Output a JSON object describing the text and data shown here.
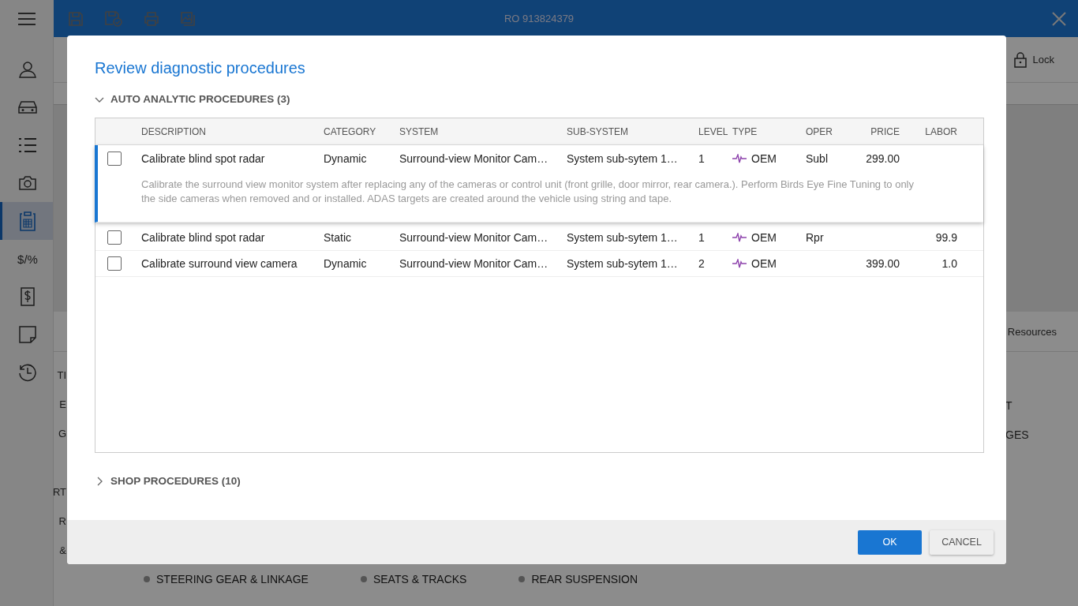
{
  "topbar": {
    "title": "RO 913824379"
  },
  "sidebar": {
    "items": [
      {
        "selected": false
      },
      {
        "selected": false
      },
      {
        "selected": false
      },
      {
        "selected": false
      },
      {
        "selected": true
      },
      {
        "selected": false,
        "glyph": "$/%"
      },
      {
        "selected": false
      },
      {
        "selected": false
      },
      {
        "selected": false
      }
    ]
  },
  "header": {
    "lock_label": "Lock"
  },
  "resources": {
    "label": "Resources"
  },
  "background_left": [
    "TI",
    "E",
    "G",
    "RT",
    "R",
    "&"
  ],
  "background_right": [
    "T",
    "GES"
  ],
  "background_tags": [
    "STEERING GEAR & LINKAGE",
    "SEATS & TRACKS",
    "REAR SUSPENSION"
  ],
  "dialog": {
    "title": "Review diagnostic procedures",
    "sections": [
      {
        "title": "AUTO ANALYTIC PROCEDURES (3)",
        "expanded": true
      },
      {
        "title": "SHOP PROCEDURES (10)",
        "expanded": false
      }
    ],
    "table": {
      "columns": [
        "DESCRIPTION",
        "CATEGORY",
        "SYSTEM",
        "SUB-SYSTEM",
        "LEVEL",
        "TYPE",
        "OPER",
        "PRICE",
        "LABOR"
      ],
      "rows": [
        {
          "checked": false,
          "expanded": true,
          "description": "Calibrate blind spot radar",
          "category": "Dynamic",
          "system": "Surround-view Monitor Cam…",
          "sub_system": "System sub-sytem 1…",
          "proc_level": "1",
          "type": "OEM",
          "oper": "Subl",
          "price": "299.00",
          "details": "Calibrate the surround view monitor system after replacing any of the cameras or control unit (front grille, door mirror, rear camera.). Perform Birds Eye Fine Tuning to only the side cameras when removed and or installed. ADAS targets are created around the vehicle using string and tape."
        },
        {
          "checked": false,
          "expanded": false,
          "description": "Calibrate blind spot radar",
          "category": "Static",
          "system": "Surround-view Monitor Cam…",
          "sub_system": "System sub-sytem 1…",
          "proc_level": "1",
          "type": "OEM",
          "oper": "Rpr",
          "labor": "99.9"
        },
        {
          "checked": false,
          "expanded": false,
          "description": "Calibrate surround view camera",
          "category": "Dynamic",
          "system": "Surround-view Monitor Cam…",
          "sub_system": "System sub-sytem 1…",
          "proc_level": "2",
          "type": "OEM",
          "price": "399.00",
          "labor": "1.0"
        }
      ]
    },
    "buttons": [
      {
        "label": "OK",
        "kind": "primary"
      },
      {
        "label": "CANCEL",
        "kind": "secondary"
      }
    ]
  }
}
